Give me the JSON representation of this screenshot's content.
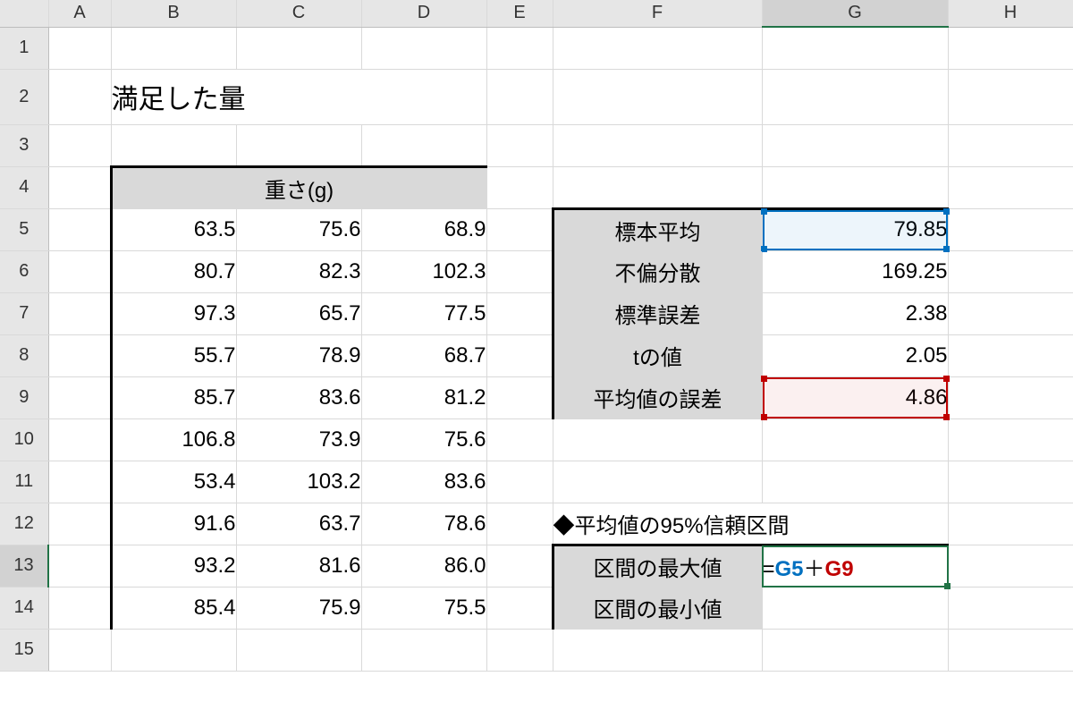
{
  "columns": [
    "A",
    "B",
    "C",
    "D",
    "E",
    "F",
    "G",
    "H"
  ],
  "rows": [
    "1",
    "2",
    "3",
    "4",
    "5",
    "6",
    "7",
    "8",
    "9",
    "10",
    "11",
    "12",
    "13",
    "14",
    "15"
  ],
  "title": "満足した量",
  "weight_table": {
    "header": "重さ(g)",
    "rows": [
      [
        "63.5",
        "75.6",
        "68.9"
      ],
      [
        "80.7",
        "82.3",
        "102.3"
      ],
      [
        "97.3",
        "65.7",
        "77.5"
      ],
      [
        "55.7",
        "78.9",
        "68.7"
      ],
      [
        "85.7",
        "83.6",
        "81.2"
      ],
      [
        "106.8",
        "73.9",
        "75.6"
      ],
      [
        "53.4",
        "103.2",
        "83.6"
      ],
      [
        "91.6",
        "63.7",
        "78.6"
      ],
      [
        "93.2",
        "81.6",
        "86.0"
      ],
      [
        "85.4",
        "75.9",
        "75.5"
      ]
    ]
  },
  "stats": {
    "rows": [
      {
        "label": "標本平均",
        "value": "79.85"
      },
      {
        "label": "不偏分散",
        "value": "169.25"
      },
      {
        "label": "標準誤差",
        "value": "2.38"
      },
      {
        "label": "tの値",
        "value": "2.05"
      },
      {
        "label": "平均値の誤差",
        "value": "4.86"
      }
    ]
  },
  "ci": {
    "heading": "◆平均値の95%信頼区間",
    "rows": [
      {
        "label": "区間の最大値"
      },
      {
        "label": "区間の最小値"
      }
    ],
    "formula": {
      "eq": "=",
      "ref1": "G5",
      "plus": "＋",
      "ref2": "G9"
    }
  }
}
